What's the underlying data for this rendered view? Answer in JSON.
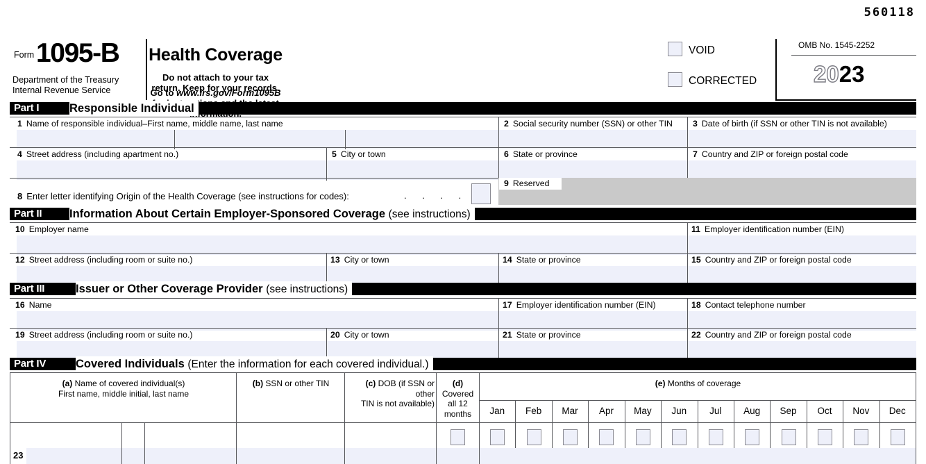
{
  "document": {
    "catalog_number": "560118",
    "form_label": "Form",
    "form_number": "1095-B",
    "agency_line1": "Department of the Treasury",
    "agency_line2": "Internal Revenue Service",
    "title": "Health Coverage",
    "subtitle": "Do not attach to your tax return. Keep for your records.",
    "goto_prefix": "Go to ",
    "goto_url": "www.irs.gov/Form1095B",
    "goto_suffix": " for instructions and the latest information.",
    "void_label": "VOID",
    "corrected_label": "CORRECTED",
    "omb_label": "OMB No. 1545-2252",
    "year_hollow": "20",
    "year_solid": "23"
  },
  "part1": {
    "tag": "Part I",
    "title": "Responsible Individual",
    "fields": [
      {
        "num": "1",
        "label": "Name of responsible individual–First name, middle name, last name"
      },
      {
        "num": "2",
        "label": "Social security number (SSN) or other TIN"
      },
      {
        "num": "3",
        "label": "Date of birth (if SSN or other TIN is not available)"
      },
      {
        "num": "4",
        "label": "Street address (including apartment no.)"
      },
      {
        "num": "5",
        "label": "City or town"
      },
      {
        "num": "6",
        "label": "State or province"
      },
      {
        "num": "7",
        "label": "Country and ZIP or foreign postal code"
      },
      {
        "num": "8",
        "label": "Enter letter identifying Origin of the Health Coverage (see instructions for codes):"
      },
      {
        "num": "9",
        "label": "Reserved"
      }
    ],
    "leader_dots": ". . . . ."
  },
  "part2": {
    "tag": "Part II",
    "title": "Information About Certain Employer-Sponsored Coverage",
    "title_note": "(see instructions)",
    "fields": [
      {
        "num": "10",
        "label": "Employer name"
      },
      {
        "num": "11",
        "label": "Employer identification number (EIN)"
      },
      {
        "num": "12",
        "label": "Street address (including room or suite no.)"
      },
      {
        "num": "13",
        "label": "City or town"
      },
      {
        "num": "14",
        "label": "State or province"
      },
      {
        "num": "15",
        "label": "Country and ZIP or foreign postal code"
      }
    ]
  },
  "part3": {
    "tag": "Part III",
    "title": "Issuer or Other Coverage Provider",
    "title_note": "(see instructions)",
    "fields": [
      {
        "num": "16",
        "label": "Name"
      },
      {
        "num": "17",
        "label": "Employer identification number (EIN)"
      },
      {
        "num": "18",
        "label": "Contact telephone number"
      },
      {
        "num": "19",
        "label": "Street address (including room or suite no.)"
      },
      {
        "num": "20",
        "label": "City or town"
      },
      {
        "num": "21",
        "label": "State or province"
      },
      {
        "num": "22",
        "label": "Country and ZIP or foreign postal code"
      }
    ]
  },
  "part4": {
    "tag": "Part IV",
    "title": "Covered Individuals",
    "title_note": "(Enter the information for each covered individual.)",
    "columns": {
      "a_tag": "(a)",
      "a_label": "Name of covered individual(s)",
      "a_sub": "First name, middle initial, last name",
      "b_tag": "(b)",
      "b_label": "SSN or other TIN",
      "c_tag": "(c)",
      "c_label": "DOB (if SSN or other",
      "c_sub": "TIN is not available)",
      "d_tag": "(d)",
      "d_label": "Covered",
      "d_sub": "all 12 months",
      "e_tag": "(e)",
      "e_label": "Months of coverage"
    },
    "months": [
      "Jan",
      "Feb",
      "Mar",
      "Apr",
      "May",
      "Jun",
      "Jul",
      "Aug",
      "Sep",
      "Oct",
      "Nov",
      "Dec"
    ],
    "rows": [
      {
        "num": "23"
      }
    ]
  },
  "colors": {
    "field_fill": "#eef0fa",
    "reserved_fill": "#c9c9c9",
    "rule": "#55565a",
    "banner": "#000000"
  }
}
